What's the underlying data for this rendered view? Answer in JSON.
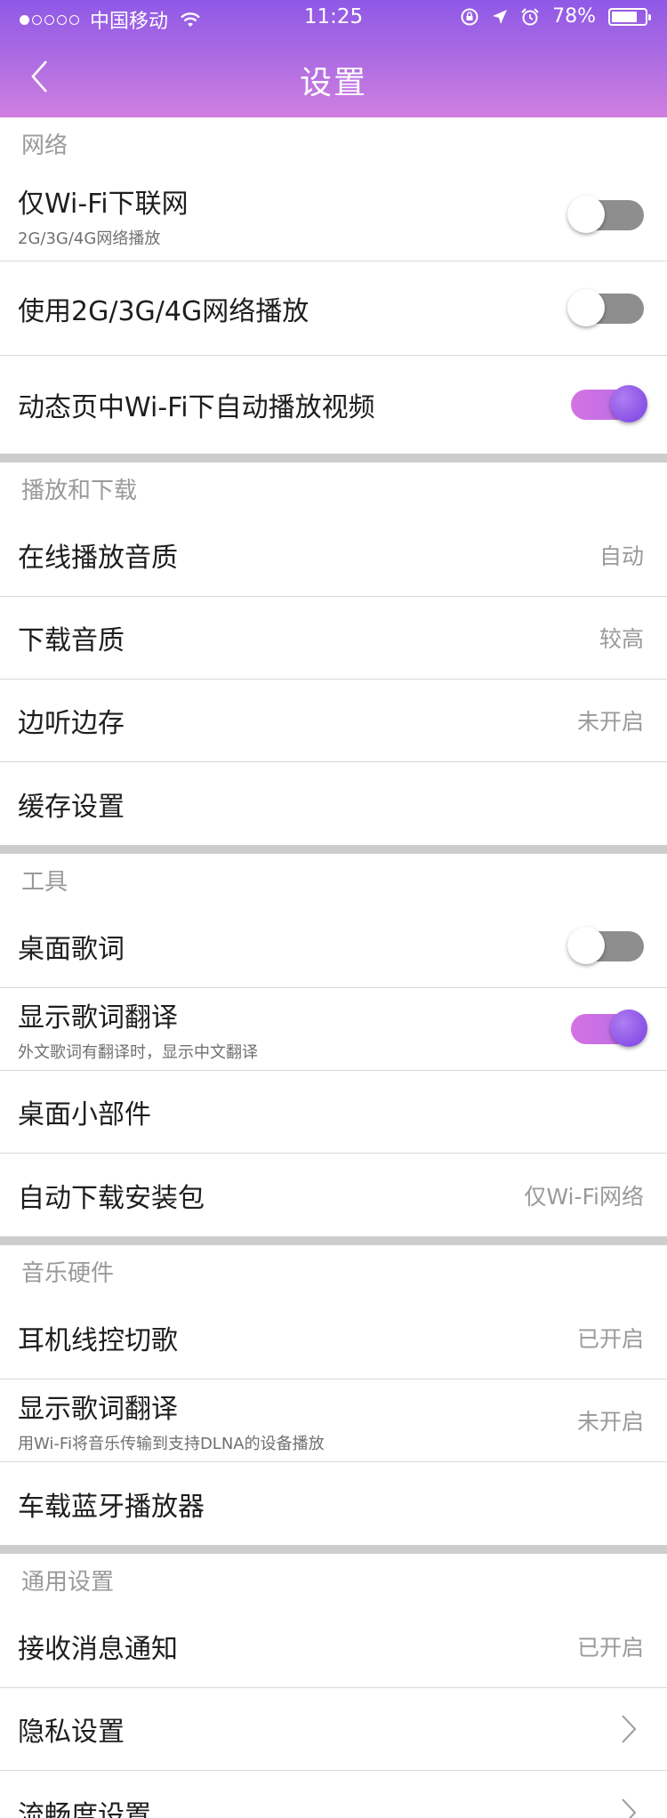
{
  "status_bar": {
    "carrier": "中国移动",
    "time": "11:25",
    "battery_percent": "78%",
    "battery_level": 0.78,
    "signal_dots_filled": 1,
    "signal_dots_total": 5
  },
  "nav": {
    "title": "设置",
    "back_icon": "chevron-left-icon"
  },
  "colors": {
    "header_top": "#8f58e6",
    "header_bottom": "#d07fe0",
    "toggle_on": "#b66de8",
    "toggle_off": "#8e8e8e"
  },
  "sections": {
    "network": {
      "title": "网络",
      "wifi_only": {
        "label": "仅Wi-Fi下联网",
        "sub": "2G/3G/4G网络播放",
        "on": false
      },
      "mobile_play": {
        "label": "使用2G/3G/4G网络播放",
        "on": false
      },
      "autoplay_video": {
        "label": "动态页中Wi-Fi下自动播放视频",
        "on": true
      }
    },
    "playback": {
      "title": "播放和下载",
      "online_quality": {
        "label": "在线播放音质",
        "value": "自动"
      },
      "download_quality": {
        "label": "下载音质",
        "value": "较高"
      },
      "listen_save": {
        "label": "边听边存",
        "value": "未开启"
      },
      "cache": {
        "label": "缓存设置"
      }
    },
    "tools": {
      "title": "工具",
      "desktop_lyrics": {
        "label": "桌面歌词",
        "on": false
      },
      "lyrics_translate": {
        "label": "显示歌词翻译",
        "sub": "外文歌词有翻译时，显示中文翻译",
        "on": true
      },
      "widget": {
        "label": "桌面小部件"
      },
      "auto_download": {
        "label": "自动下载安装包",
        "value": "仅Wi-Fi网络"
      }
    },
    "hardware": {
      "title": "音乐硬件",
      "headset": {
        "label": "耳机线控切歌",
        "value": "已开启"
      },
      "dlna": {
        "label": "显示歌词翻译",
        "sub": "用Wi-Fi将音乐传输到支持DLNA的设备播放",
        "value": "未开启"
      },
      "car_bt": {
        "label": "车载蓝牙播放器"
      }
    },
    "general": {
      "title": "通用设置",
      "notifications": {
        "label": "接收消息通知",
        "value": "已开启"
      },
      "privacy": {
        "label": "隐私设置"
      },
      "fluency": {
        "label": "流畅度设置"
      }
    }
  }
}
